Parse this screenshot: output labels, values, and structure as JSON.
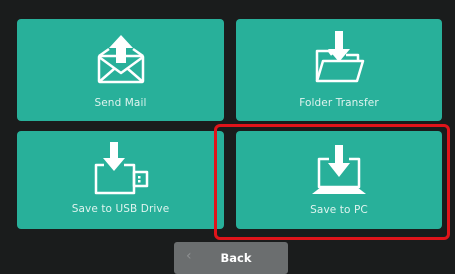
{
  "tiles": {
    "send_mail": {
      "label": "Send Mail",
      "icon": "mail-upload-icon"
    },
    "folder_transfer": {
      "label": "Folder Transfer",
      "icon": "folder-download-icon"
    },
    "save_usb": {
      "label": "Save to USB Drive",
      "icon": "usb-download-icon"
    },
    "save_pc": {
      "label": "Save to PC",
      "icon": "laptop-download-icon"
    }
  },
  "back": {
    "label": "Back",
    "icon": "chevron-left-icon"
  },
  "colors": {
    "background": "#1a1c1c",
    "tile": "#28b09a",
    "highlight": "#e0141a",
    "back_button": "#6b6e6f"
  }
}
